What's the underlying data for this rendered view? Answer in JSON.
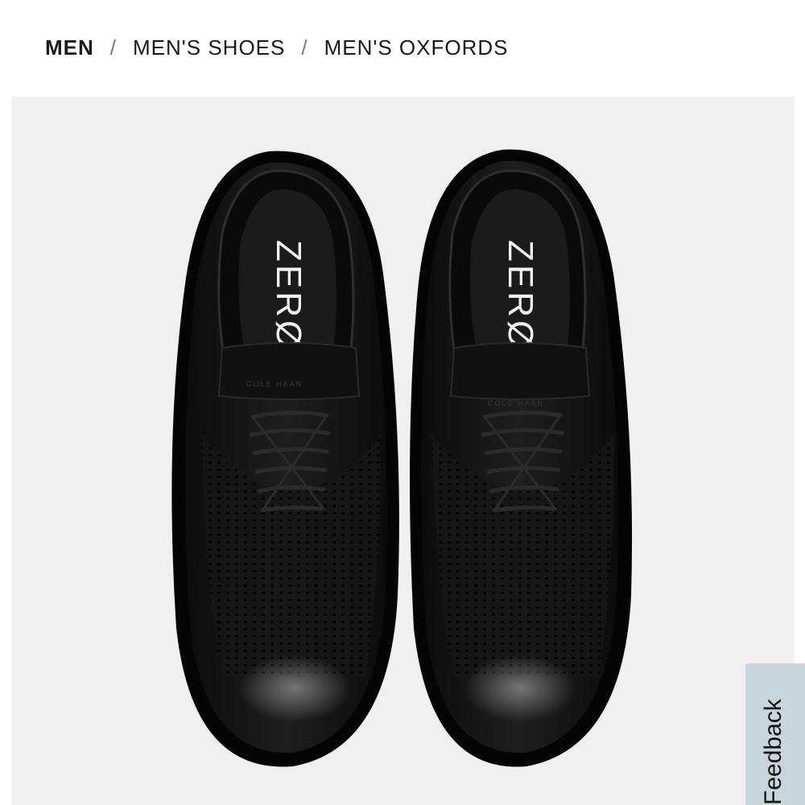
{
  "breadcrumb": {
    "items": [
      "MEN",
      "MEN'S SHOES",
      "MEN'S OXFORDS"
    ],
    "separator": "/"
  },
  "product_image": {
    "insole_brand_left": "ZERØ",
    "insole_brand_right": "ZERØ",
    "tongue_brand_left": "COLE HAAN",
    "tongue_brand_right": "COLE HAAN",
    "background_color": "#f0f0f0",
    "shoe_color": "#151515",
    "logo_accent_color": "#d4a52a"
  },
  "feedback": {
    "label": "Feedback",
    "color": "#c8d6dc"
  }
}
